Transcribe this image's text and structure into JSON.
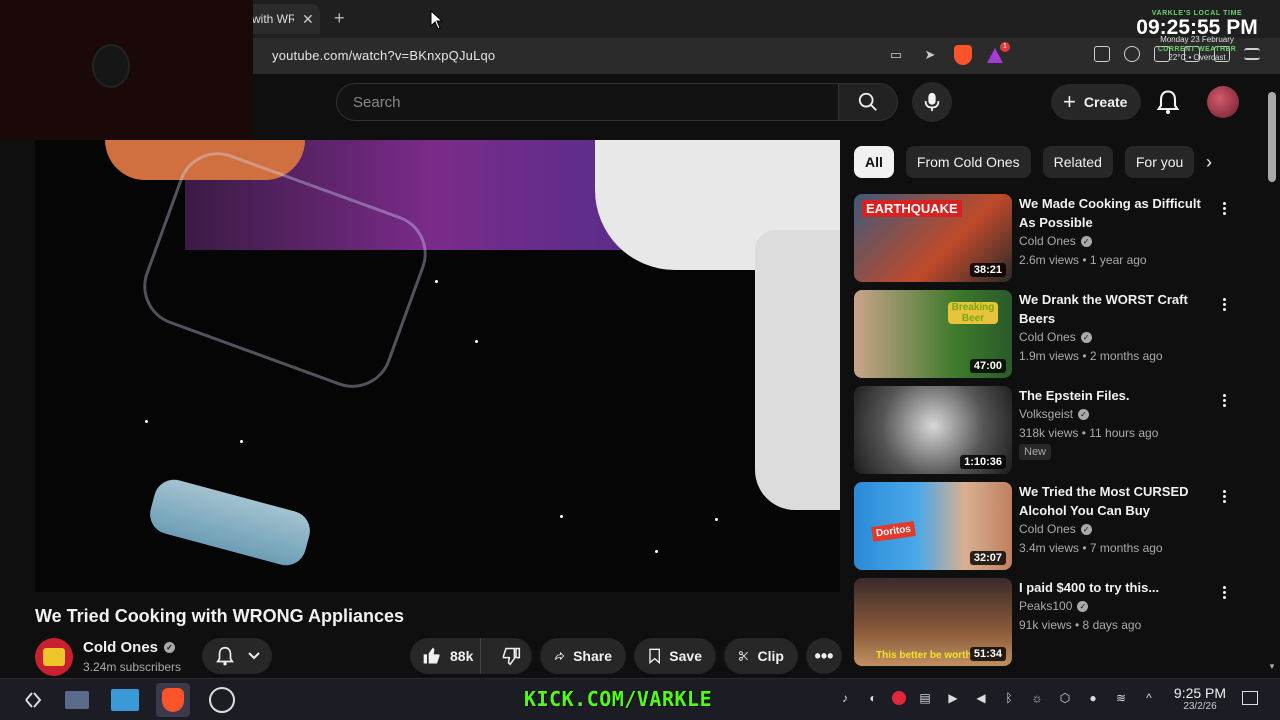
{
  "browser": {
    "tab_title": "with WR",
    "url": "youtube.com/watch?v=BKnxpQJuLqo",
    "rewards_badge": "1"
  },
  "overlay": {
    "clock_label": "VARKLE'S LOCAL TIME",
    "time": "09:25:55 PM",
    "date": "Monday 23 February",
    "weather_label": "CURRENT WEATHER",
    "weather": "22°C • Overcast"
  },
  "header": {
    "search_placeholder": "Search",
    "create_label": "Create"
  },
  "video": {
    "title": "We Tried Cooking with WRONG Appliances",
    "channel": "Cold Ones",
    "subscribers": "3.24m subscribers",
    "likes": "88k",
    "share_label": "Share",
    "save_label": "Save",
    "clip_label": "Clip"
  },
  "chips": [
    "All",
    "From Cold Ones",
    "Related",
    "For you"
  ],
  "recommendations": [
    {
      "title_line1": "We Made Cooking as Difficult",
      "title_line2": "As Possible",
      "channel": "Cold Ones",
      "meta": "2.6m views • 1 year ago",
      "duration": "38:21",
      "thumb_text": "EARTHQUAKE"
    },
    {
      "title_line1": "We Drank the WORST Craft",
      "title_line2": "Beers",
      "channel": "Cold Ones",
      "meta": "1.9m views • 2 months ago",
      "duration": "47:00",
      "thumb_text": "Breaking Beer"
    },
    {
      "title_line1": "The Epstein Files.",
      "title_line2": "",
      "channel": "Volksgeist",
      "meta": "318k views • 11 hours ago",
      "duration": "1:10:36",
      "badge": "New"
    },
    {
      "title_line1": "We Tried the Most CURSED",
      "title_line2": "Alcohol You Can Buy",
      "channel": "Cold Ones",
      "meta": "3.4m views • 7 months ago",
      "duration": "32:07",
      "thumb_text": "Doritos"
    },
    {
      "title_line1": "I paid $400 to try this...",
      "title_line2": "",
      "channel": "Peaks100",
      "meta": "91k views • 8 days ago",
      "duration": "51:34",
      "thumb_text": "This better be worth"
    }
  ],
  "taskbar": {
    "stream_url": "KICK.COM/VARKLE",
    "time": "9:25 PM",
    "date": "23/2/26"
  }
}
